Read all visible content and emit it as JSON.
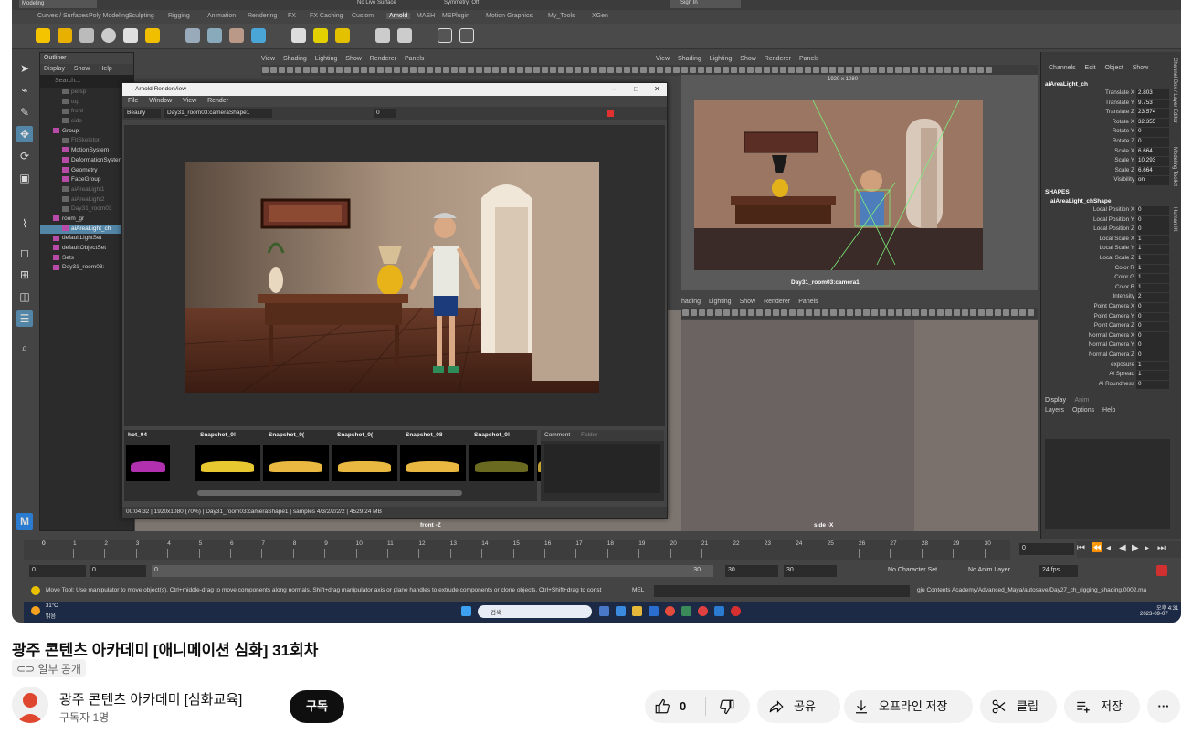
{
  "maya": {
    "mode_menu": "Modeling",
    "live_surface": "No Live Surface",
    "symmetry": "Symmetry: Off",
    "sign_in": "Sign In",
    "shelf_tabs": [
      "Curves / Surfaces",
      "Poly Modeling",
      "Sculpting",
      "Rigging",
      "Animation",
      "Rendering",
      "FX",
      "FX Caching",
      "Custom",
      "Arnold",
      "MASH",
      "MSPlugin",
      "Motion Graphics",
      "My_Tools",
      "XGen"
    ],
    "active_shelf_tab": "Arnold",
    "outliner": {
      "title": "Outliner",
      "menu": [
        "Display",
        "Show",
        "Help"
      ],
      "search_placeholder": "Search...",
      "items": [
        {
          "label": "persp",
          "indent": 2,
          "style": "dim"
        },
        {
          "label": "top",
          "indent": 2,
          "style": "dim"
        },
        {
          "label": "front",
          "indent": 2,
          "style": "dim"
        },
        {
          "label": "side",
          "indent": 2,
          "style": "dim"
        },
        {
          "label": "Group",
          "indent": 1,
          "style": "normal"
        },
        {
          "label": "FitSkeleton",
          "indent": 2,
          "style": "dim"
        },
        {
          "label": "MotionSystem",
          "indent": 2,
          "style": "normal"
        },
        {
          "label": "DeformationSystem",
          "indent": 2,
          "style": "normal"
        },
        {
          "label": "Geometry",
          "indent": 2,
          "style": "normal"
        },
        {
          "label": "FaceGroup",
          "indent": 2,
          "style": "normal"
        },
        {
          "label": "aiAreaLight1",
          "indent": 2,
          "style": "dim"
        },
        {
          "label": "aiAreaLight2",
          "indent": 2,
          "style": "dim"
        },
        {
          "label": "Day31_room03",
          "indent": 2,
          "style": "dim"
        },
        {
          "label": "room_gr",
          "indent": 1,
          "style": "normal"
        },
        {
          "label": "aiAreaLight_ch",
          "indent": 2,
          "style": "sel"
        },
        {
          "label": "defaultLightSet",
          "indent": 1,
          "style": "normal"
        },
        {
          "label": "defaultObjectSet",
          "indent": 1,
          "style": "normal"
        },
        {
          "label": "Sets",
          "indent": 1,
          "style": "normal"
        },
        {
          "label": "Day31_room03:",
          "indent": 1,
          "style": "normal"
        }
      ]
    },
    "viewport_menu": [
      "View",
      "Shading",
      "Lighting",
      "Show",
      "Renderer",
      "Panels"
    ],
    "viewport_menu_partial": [
      "hading",
      "Lighting",
      "Show",
      "Renderer",
      "Panels"
    ],
    "resolution_gate": "1920 x 1080",
    "camera_label": "Day31_room03:camera1",
    "front_label": "front -Z",
    "side_label": "side -X",
    "render_view": {
      "title": "Arnold RenderView",
      "menu": [
        "File",
        "Window",
        "View",
        "Render"
      ],
      "aov": "Beauty",
      "camera": "Day31_room03:cameraShape1",
      "exposure": "0",
      "snapshots": [
        "hot_04",
        "Snapshot_0!",
        "Snapshot_0(",
        "Snapshot_0(",
        "Snapshot_08",
        "Snapshot_0!",
        "Snaj"
      ],
      "comment_tabs": [
        "Comment",
        "Folder"
      ],
      "status": "00:04:32 | 1920x1080 (70%) | Day31_room03:cameraShape1 | samples 4/3/2/2/2/2 | 4529.24 MB"
    },
    "channel_box": {
      "menu": [
        "Channels",
        "Edit",
        "Object",
        "Show"
      ],
      "object": "aiAreaLight_ch",
      "channels": [
        {
          "label": "Translate X",
          "value": "2.803"
        },
        {
          "label": "Translate Y",
          "value": "9.753"
        },
        {
          "label": "Translate Z",
          "value": "23.574"
        },
        {
          "label": "Rotate X",
          "value": "32.355"
        },
        {
          "label": "Rotate Y",
          "value": "0"
        },
        {
          "label": "Rotate Z",
          "value": "0"
        },
        {
          "label": "Scale X",
          "value": "6.664"
        },
        {
          "label": "Scale Y",
          "value": "10.293"
        },
        {
          "label": "Scale Z",
          "value": "6.664"
        },
        {
          "label": "Visibility",
          "value": "on"
        }
      ],
      "shapes_heading": "SHAPES",
      "shape_name": "aiAreaLight_chShape",
      "shape_channels": [
        {
          "label": "Local Position X",
          "value": "0"
        },
        {
          "label": "Local Position Y",
          "value": "0"
        },
        {
          "label": "Local Position Z",
          "value": "0"
        },
        {
          "label": "Local Scale X",
          "value": "1"
        },
        {
          "label": "Local Scale Y",
          "value": "1"
        },
        {
          "label": "Local Scale Z",
          "value": "1"
        },
        {
          "label": "Color R",
          "value": "1"
        },
        {
          "label": "Color G",
          "value": "1"
        },
        {
          "label": "Color B",
          "value": "1"
        },
        {
          "label": "Intensity",
          "value": "2"
        },
        {
          "label": "Point Camera X",
          "value": "0"
        },
        {
          "label": "Point Camera Y",
          "value": "0"
        },
        {
          "label": "Point Camera Z",
          "value": "0"
        },
        {
          "label": "Normal Camera X",
          "value": "0"
        },
        {
          "label": "Normal Camera Y",
          "value": "0"
        },
        {
          "label": "Normal Camera Z",
          "value": "0"
        },
        {
          "label": "exposure",
          "value": "1"
        },
        {
          "label": "Ai Spread",
          "value": "1"
        },
        {
          "label": "Ai Roundness",
          "value": "0"
        }
      ],
      "layer_tabs": [
        "Display",
        "Anim"
      ],
      "layer_menu": [
        "Layers",
        "Options",
        "Help"
      ],
      "side_tabs": [
        "Channel Box / Layer Editor",
        "Modeling Toolkit",
        "Human IK"
      ]
    },
    "timeline": {
      "ticks": [
        "1",
        "2",
        "3",
        "4",
        "5",
        "6",
        "7",
        "8",
        "9",
        "10",
        "11",
        "12",
        "13",
        "14",
        "15",
        "16",
        "17",
        "18",
        "19",
        "20",
        "21",
        "22",
        "23",
        "24",
        "25",
        "26",
        "27",
        "28",
        "29",
        "30"
      ],
      "current_frame": "0",
      "start": "0",
      "start2": "0",
      "range_start": "0",
      "range_end": "30",
      "end": "30",
      "end2": "30",
      "character_set": "No Character Set",
      "anim_layer": "No Anim Layer",
      "fps": "24 fps"
    },
    "help_line": "Move Tool: Use manipulator to move object(s). Ctrl+middle-drag to move components along normals. Shift+drag manipulator axis or plane handles to extrude components or clone objects. Ctrl+Shift+drag to const",
    "mel_label": "MEL",
    "file_path": "gju Contents Academy/Advanced_Maya/autosave/Day27_ch_rigging_shading.0002.ma",
    "taskbar": {
      "weather_temp": "31°C",
      "weather_desc": "맑음",
      "search_placeholder": "검색",
      "time": "오후 4:31",
      "date": "2023-09-07"
    }
  },
  "youtube": {
    "title": "광주 콘텐츠 아카데미 [애니메이션 심화] 31회차",
    "visibility": "일부 공개",
    "channel_name": "광주 콘텐츠 아카데미 [심화교육]",
    "subscribers": "구독자 1명",
    "subscribe_label": "구독",
    "like_count": "0",
    "share_label": "공유",
    "download_label": "오프라인 저장",
    "clip_label": "클립",
    "save_label": "저장"
  }
}
